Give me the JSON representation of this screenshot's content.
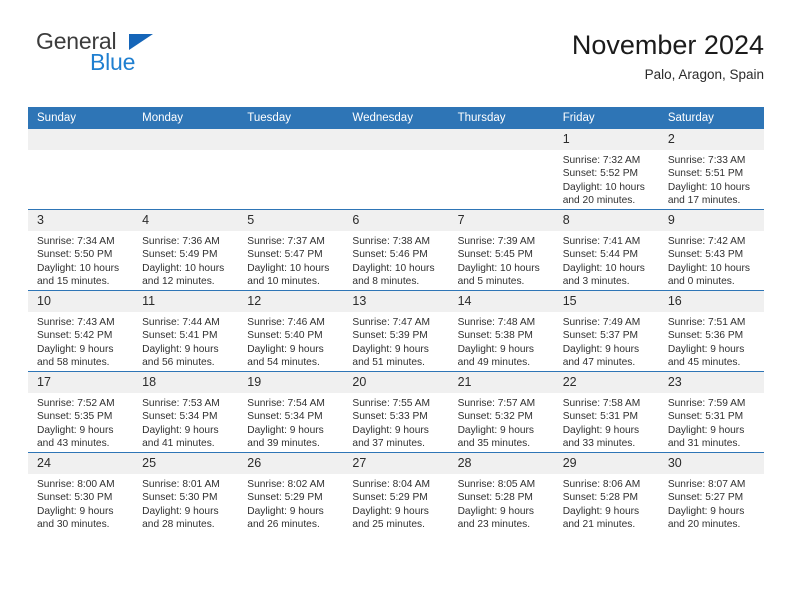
{
  "brand": {
    "name_part1": "General",
    "name_part2": "Blue"
  },
  "header": {
    "title": "November 2024",
    "location": "Palo, Aragon, Spain"
  },
  "colors": {
    "header_blue": "#2e75b6",
    "logo_blue": "#1f7fd0",
    "daynum_band": "#f0f0f0"
  },
  "calendar": {
    "weekday_headers": [
      "Sunday",
      "Monday",
      "Tuesday",
      "Wednesday",
      "Thursday",
      "Friday",
      "Saturday"
    ],
    "weeks": [
      [
        {
          "day": "",
          "empty": true
        },
        {
          "day": "",
          "empty": true
        },
        {
          "day": "",
          "empty": true
        },
        {
          "day": "",
          "empty": true
        },
        {
          "day": "",
          "empty": true
        },
        {
          "day": "1",
          "sunrise": "Sunrise: 7:32 AM",
          "sunset": "Sunset: 5:52 PM",
          "daylight_line1": "Daylight: 10 hours",
          "daylight_line2": "and 20 minutes."
        },
        {
          "day": "2",
          "sunrise": "Sunrise: 7:33 AM",
          "sunset": "Sunset: 5:51 PM",
          "daylight_line1": "Daylight: 10 hours",
          "daylight_line2": "and 17 minutes."
        }
      ],
      [
        {
          "day": "3",
          "sunrise": "Sunrise: 7:34 AM",
          "sunset": "Sunset: 5:50 PM",
          "daylight_line1": "Daylight: 10 hours",
          "daylight_line2": "and 15 minutes."
        },
        {
          "day": "4",
          "sunrise": "Sunrise: 7:36 AM",
          "sunset": "Sunset: 5:49 PM",
          "daylight_line1": "Daylight: 10 hours",
          "daylight_line2": "and 12 minutes."
        },
        {
          "day": "5",
          "sunrise": "Sunrise: 7:37 AM",
          "sunset": "Sunset: 5:47 PM",
          "daylight_line1": "Daylight: 10 hours",
          "daylight_line2": "and 10 minutes."
        },
        {
          "day": "6",
          "sunrise": "Sunrise: 7:38 AM",
          "sunset": "Sunset: 5:46 PM",
          "daylight_line1": "Daylight: 10 hours",
          "daylight_line2": "and 8 minutes."
        },
        {
          "day": "7",
          "sunrise": "Sunrise: 7:39 AM",
          "sunset": "Sunset: 5:45 PM",
          "daylight_line1": "Daylight: 10 hours",
          "daylight_line2": "and 5 minutes."
        },
        {
          "day": "8",
          "sunrise": "Sunrise: 7:41 AM",
          "sunset": "Sunset: 5:44 PM",
          "daylight_line1": "Daylight: 10 hours",
          "daylight_line2": "and 3 minutes."
        },
        {
          "day": "9",
          "sunrise": "Sunrise: 7:42 AM",
          "sunset": "Sunset: 5:43 PM",
          "daylight_line1": "Daylight: 10 hours",
          "daylight_line2": "and 0 minutes."
        }
      ],
      [
        {
          "day": "10",
          "sunrise": "Sunrise: 7:43 AM",
          "sunset": "Sunset: 5:42 PM",
          "daylight_line1": "Daylight: 9 hours",
          "daylight_line2": "and 58 minutes."
        },
        {
          "day": "11",
          "sunrise": "Sunrise: 7:44 AM",
          "sunset": "Sunset: 5:41 PM",
          "daylight_line1": "Daylight: 9 hours",
          "daylight_line2": "and 56 minutes."
        },
        {
          "day": "12",
          "sunrise": "Sunrise: 7:46 AM",
          "sunset": "Sunset: 5:40 PM",
          "daylight_line1": "Daylight: 9 hours",
          "daylight_line2": "and 54 minutes."
        },
        {
          "day": "13",
          "sunrise": "Sunrise: 7:47 AM",
          "sunset": "Sunset: 5:39 PM",
          "daylight_line1": "Daylight: 9 hours",
          "daylight_line2": "and 51 minutes."
        },
        {
          "day": "14",
          "sunrise": "Sunrise: 7:48 AM",
          "sunset": "Sunset: 5:38 PM",
          "daylight_line1": "Daylight: 9 hours",
          "daylight_line2": "and 49 minutes."
        },
        {
          "day": "15",
          "sunrise": "Sunrise: 7:49 AM",
          "sunset": "Sunset: 5:37 PM",
          "daylight_line1": "Daylight: 9 hours",
          "daylight_line2": "and 47 minutes."
        },
        {
          "day": "16",
          "sunrise": "Sunrise: 7:51 AM",
          "sunset": "Sunset: 5:36 PM",
          "daylight_line1": "Daylight: 9 hours",
          "daylight_line2": "and 45 minutes."
        }
      ],
      [
        {
          "day": "17",
          "sunrise": "Sunrise: 7:52 AM",
          "sunset": "Sunset: 5:35 PM",
          "daylight_line1": "Daylight: 9 hours",
          "daylight_line2": "and 43 minutes."
        },
        {
          "day": "18",
          "sunrise": "Sunrise: 7:53 AM",
          "sunset": "Sunset: 5:34 PM",
          "daylight_line1": "Daylight: 9 hours",
          "daylight_line2": "and 41 minutes."
        },
        {
          "day": "19",
          "sunrise": "Sunrise: 7:54 AM",
          "sunset": "Sunset: 5:34 PM",
          "daylight_line1": "Daylight: 9 hours",
          "daylight_line2": "and 39 minutes."
        },
        {
          "day": "20",
          "sunrise": "Sunrise: 7:55 AM",
          "sunset": "Sunset: 5:33 PM",
          "daylight_line1": "Daylight: 9 hours",
          "daylight_line2": "and 37 minutes."
        },
        {
          "day": "21",
          "sunrise": "Sunrise: 7:57 AM",
          "sunset": "Sunset: 5:32 PM",
          "daylight_line1": "Daylight: 9 hours",
          "daylight_line2": "and 35 minutes."
        },
        {
          "day": "22",
          "sunrise": "Sunrise: 7:58 AM",
          "sunset": "Sunset: 5:31 PM",
          "daylight_line1": "Daylight: 9 hours",
          "daylight_line2": "and 33 minutes."
        },
        {
          "day": "23",
          "sunrise": "Sunrise: 7:59 AM",
          "sunset": "Sunset: 5:31 PM",
          "daylight_line1": "Daylight: 9 hours",
          "daylight_line2": "and 31 minutes."
        }
      ],
      [
        {
          "day": "24",
          "sunrise": "Sunrise: 8:00 AM",
          "sunset": "Sunset: 5:30 PM",
          "daylight_line1": "Daylight: 9 hours",
          "daylight_line2": "and 30 minutes."
        },
        {
          "day": "25",
          "sunrise": "Sunrise: 8:01 AM",
          "sunset": "Sunset: 5:30 PM",
          "daylight_line1": "Daylight: 9 hours",
          "daylight_line2": "and 28 minutes."
        },
        {
          "day": "26",
          "sunrise": "Sunrise: 8:02 AM",
          "sunset": "Sunset: 5:29 PM",
          "daylight_line1": "Daylight: 9 hours",
          "daylight_line2": "and 26 minutes."
        },
        {
          "day": "27",
          "sunrise": "Sunrise: 8:04 AM",
          "sunset": "Sunset: 5:29 PM",
          "daylight_line1": "Daylight: 9 hours",
          "daylight_line2": "and 25 minutes."
        },
        {
          "day": "28",
          "sunrise": "Sunrise: 8:05 AM",
          "sunset": "Sunset: 5:28 PM",
          "daylight_line1": "Daylight: 9 hours",
          "daylight_line2": "and 23 minutes."
        },
        {
          "day": "29",
          "sunrise": "Sunrise: 8:06 AM",
          "sunset": "Sunset: 5:28 PM",
          "daylight_line1": "Daylight: 9 hours",
          "daylight_line2": "and 21 minutes."
        },
        {
          "day": "30",
          "sunrise": "Sunrise: 8:07 AM",
          "sunset": "Sunset: 5:27 PM",
          "daylight_line1": "Daylight: 9 hours",
          "daylight_line2": "and 20 minutes."
        }
      ]
    ]
  }
}
